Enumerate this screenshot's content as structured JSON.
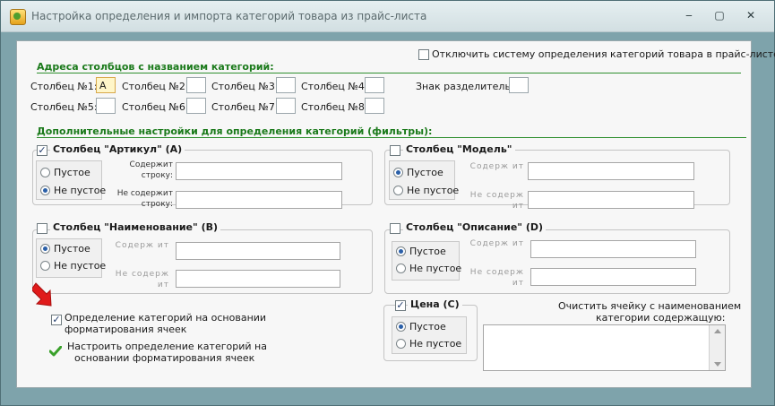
{
  "window": {
    "title": "Настройка определения и импорта категорий товара из прайс-листа",
    "minimize": "‒",
    "maximize": "▢",
    "close": "✕"
  },
  "top": {
    "disable_label": "Отключить систему определения категорий товара в прайс-листе",
    "disable_checked": false
  },
  "columns_section": {
    "title": "Адреса столбцов с названием категорий:",
    "fields": [
      {
        "label": "Столбец №1:",
        "value": "A"
      },
      {
        "label": "Столбец №2:",
        "value": ""
      },
      {
        "label": "Столбец №3:",
        "value": ""
      },
      {
        "label": "Столбец №4:",
        "value": ""
      },
      {
        "label": "Столбец №5:",
        "value": ""
      },
      {
        "label": "Столбец №6:",
        "value": ""
      },
      {
        "label": "Столбец №7:",
        "value": ""
      },
      {
        "label": "Столбец №8:",
        "value": ""
      }
    ],
    "separator_label": "Знак разделитель:",
    "separator_value": ""
  },
  "filters_section": {
    "title": "Дополнительные настройки для определения категорий (фильтры):",
    "article": {
      "title": "Столбец \"Артикул\" (A)",
      "checked": true,
      "empty": "Пустое",
      "not_empty": "Не пустое",
      "selected": "not_empty",
      "contains_label": "Содержит строку:",
      "not_contains_label": "Не содержит строку:"
    },
    "model": {
      "title": "Столбец \"Модель\"",
      "checked": false,
      "empty": "Пустое",
      "not_empty": "Не пустое",
      "selected": "empty",
      "contains_label": "Содерж ит",
      "not_contains_label": "Не содерж ит"
    },
    "name": {
      "title": "Столбец \"Наименование\" (B)",
      "checked": false,
      "empty": "Пустое",
      "not_empty": "Не пустое",
      "selected": "empty",
      "contains_label": "Содерж ит",
      "not_contains_label": "Не содерж ит"
    },
    "description": {
      "title": "Столбец \"Описание\" (D)",
      "checked": false,
      "empty": "Пустое",
      "not_empty": "Не пустое",
      "selected": "empty",
      "contains_label": "Содерж ит",
      "not_contains_label": "Не содерж ит"
    },
    "price": {
      "title": "Цена (C)",
      "checked": true,
      "empty": "Пустое",
      "not_empty": "Не пустое",
      "selected": "empty"
    }
  },
  "formatting": {
    "checkbox_label_1": "Определение категорий на основании",
    "checkbox_label_2": "форматирования ячеек",
    "checked": true,
    "link_label_1": "Настроить определение категорий на",
    "link_label_2": "основании форматирования ячеек"
  },
  "clear": {
    "label_1": "Очистить ячейку с наименованием",
    "label_2": "категории содержащую:"
  },
  "colors": {
    "section_green": "#1b7a1b",
    "focus_yellow": "#fff6c9",
    "check_green": "#3aa12b",
    "arrow_red": "#e01b1b"
  }
}
